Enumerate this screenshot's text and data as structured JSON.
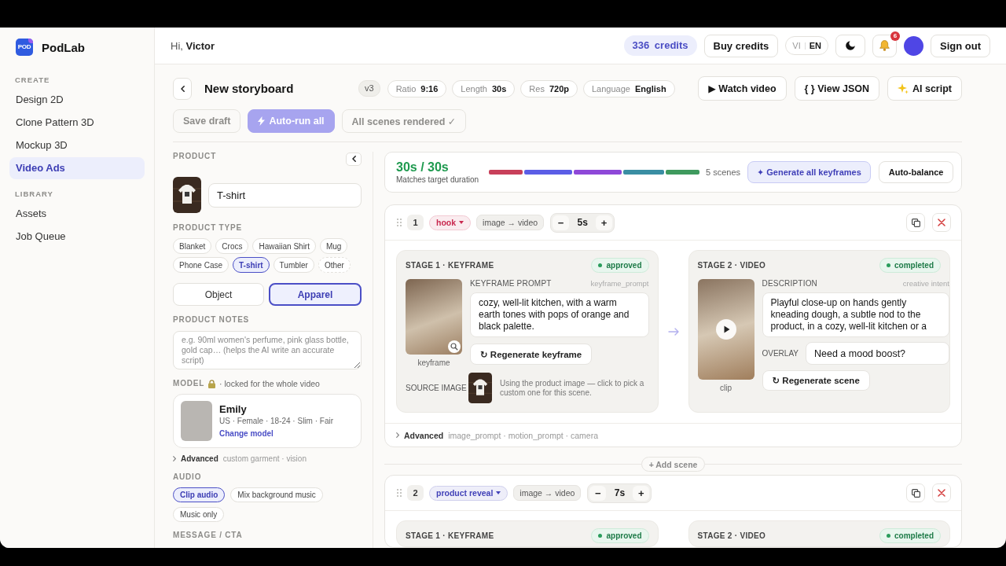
{
  "sidebar": {
    "logo_mark": "POD",
    "brand": "PodLab",
    "sections": [
      {
        "title": "CREATE",
        "items": [
          {
            "label": "Design 2D",
            "selected": false
          },
          {
            "label": "Clone Pattern 3D",
            "selected": false
          },
          {
            "label": "Mockup 3D",
            "selected": false
          },
          {
            "label": "Video Ads",
            "selected": true
          }
        ]
      },
      {
        "title": "LIBRARY",
        "items": [
          {
            "label": "Assets",
            "selected": false
          },
          {
            "label": "Job Queue",
            "selected": false
          }
        ]
      }
    ]
  },
  "header": {
    "greeting": "Hi, **Victor**",
    "credits": "336 credits",
    "buy_button": "Buy credits",
    "languages": [
      {
        "label": "VI",
        "selected": false
      },
      {
        "label": "EN",
        "selected": true
      }
    ],
    "notification_count": "6",
    "sign_out_button": "Sign out"
  },
  "storyboard": {
    "title": "New storyboard",
    "version": "v3",
    "settings": [
      {
        "label": "Ratio",
        "value": "9:16"
      },
      {
        "label": "Length",
        "value": "30s"
      },
      {
        "label": "Res",
        "value": "720p"
      },
      {
        "label": "Language",
        "value": "English"
      }
    ],
    "actions": [
      {
        "kind": "watch",
        "label": "▶ Watch video"
      },
      {
        "kind": "json",
        "label": "{ } View JSON"
      },
      {
        "kind": "script",
        "label": "AI script"
      }
    ],
    "toolbar": [
      {
        "kind": "save",
        "label": "Save draft",
        "disabled": true
      },
      {
        "kind": "autorun",
        "label": "Auto-run all",
        "disabled": true
      },
      {
        "kind": "status",
        "label": "All scenes rendered ✓",
        "disabled": true
      }
    ]
  },
  "product": {
    "label": "PRODUCT",
    "name": "T-shirt",
    "type_label": "PRODUCT TYPE",
    "types": [
      {
        "label": "Blanket",
        "kind": "option",
        "selected": false
      },
      {
        "label": "Crocs",
        "kind": "option",
        "selected": false
      },
      {
        "label": "Hawaiian Shirt",
        "kind": "option",
        "selected": false
      },
      {
        "label": "Mug",
        "kind": "option",
        "selected": false
      },
      {
        "label": "Phone Case",
        "kind": "option",
        "selected": false
      },
      {
        "label": "T-shirt",
        "kind": "option",
        "selected": true
      },
      {
        "label": "Tumbler",
        "kind": "option",
        "selected": false
      },
      {
        "label": "Other",
        "kind": "other",
        "selected": false
      }
    ],
    "categories": [
      {
        "label": "Object",
        "selected": false
      },
      {
        "label": "Apparel",
        "selected": true
      }
    ],
    "notes": {
      "label": "PRODUCT NOTES",
      "placeholder": "e.g. 90ml women's perfume, pink glass bottle, gold cap… (helps the AI write an accurate script)"
    },
    "model": {
      "label": "MODEL",
      "note": "· locked for the whole video",
      "name": "Emily",
      "details": "US · Female · 18-24 · Slim · Fair",
      "link": "Change model"
    },
    "advanced": {
      "label": "Advanced",
      "hint": "custom garment · vision"
    },
    "audio": {
      "label": "AUDIO",
      "options": [
        {
          "label": "Clip audio",
          "selected": true
        },
        {
          "label": "Mix background music",
          "selected": false
        },
        {
          "label": "Music only",
          "selected": false
        }
      ]
    },
    "message_label": "MESSAGE / CTA"
  },
  "summary": {
    "total": "30s / 30s",
    "caption": "Matches target duration",
    "scene_count": "5 scenes",
    "generate_button": "✦ Generate all keyframes",
    "balance_button": "Auto-balance"
  },
  "scenes": [
    {
      "number": "1",
      "tag": {
        "label": "hook",
        "color": "#c9294f"
      },
      "mode": "image → video",
      "decrease": "−",
      "duration": "5s",
      "increase": "+",
      "stages": [
        {
          "kind": "keyframe",
          "title": "STAGE 1 · KEYFRAME",
          "status": "approved",
          "caption": "keyframe",
          "field_label": "KEYFRAME PROMPT",
          "field_key": "keyframe_prompt",
          "text": "cozy, well-lit kitchen, with a warm earth tones with pops of orange and black palette.",
          "button": "↻ Regenerate keyframe",
          "source_label": "SOURCE IMAGE",
          "source_note": "Using the product image — click to pick a custom one for this scene."
        },
        {
          "kind": "video",
          "title": "STAGE 2 · VIDEO",
          "status": "completed",
          "caption": "clip",
          "field_label": "DESCRIPTION",
          "field_key": "creative intent",
          "text": "Playful close-up on hands gently kneading dough, a subtle nod to the product, in a cozy, well-lit kitchen or a",
          "overlay_label": "OVERLAY",
          "overlay": "Need a mood boost?",
          "button": "↻ Regenerate scene"
        }
      ],
      "advanced": {
        "label": "Advanced",
        "hint": "image_prompt · motion_prompt · camera"
      },
      "add_scene_button": "+ Add scene"
    },
    {
      "number": "2",
      "tag": {
        "label": "product reveal",
        "color": "#4242b8"
      },
      "mode": "image → video",
      "decrease": "−",
      "duration": "7s",
      "increase": "+",
      "stages": [
        {
          "title": "STAGE 1 · KEYFRAME",
          "status": "approved"
        },
        {
          "title": "STAGE 2 · VIDEO",
          "status": "completed"
        }
      ]
    }
  ]
}
